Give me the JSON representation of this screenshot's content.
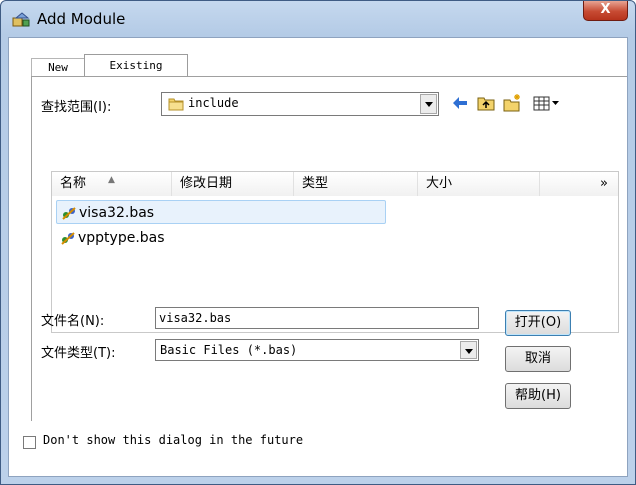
{
  "window": {
    "title": "Add Module",
    "close_label": "X"
  },
  "tabs": [
    {
      "label": "New"
    },
    {
      "label": "Existing"
    }
  ],
  "lookin": {
    "label": "查找范围(I):",
    "value": "include"
  },
  "toolbar": {
    "icons": [
      "back-arrow-icon",
      "up-folder-icon",
      "new-folder-icon",
      "view-menu-icon"
    ]
  },
  "filelist": {
    "columns": [
      "名称",
      "修改日期",
      "类型",
      "大小"
    ],
    "more": "»",
    "items": [
      {
        "name": "visa32.bas",
        "selected": true
      },
      {
        "name": "vpptype.bas",
        "selected": false
      }
    ]
  },
  "filename": {
    "label": "文件名(N):",
    "value": "visa32.bas"
  },
  "filetype": {
    "label": "文件类型(T):",
    "value": "Basic Files (*.bas)"
  },
  "buttons": {
    "open": "打开(O)",
    "cancel": "取消",
    "help": "帮助(H)"
  },
  "footer": {
    "checkbox_label": "Don't show this dialog in the future"
  },
  "colors": {
    "accent": "#3c7fb1",
    "selection": "#e8f2fc",
    "close": "#c74b33"
  }
}
